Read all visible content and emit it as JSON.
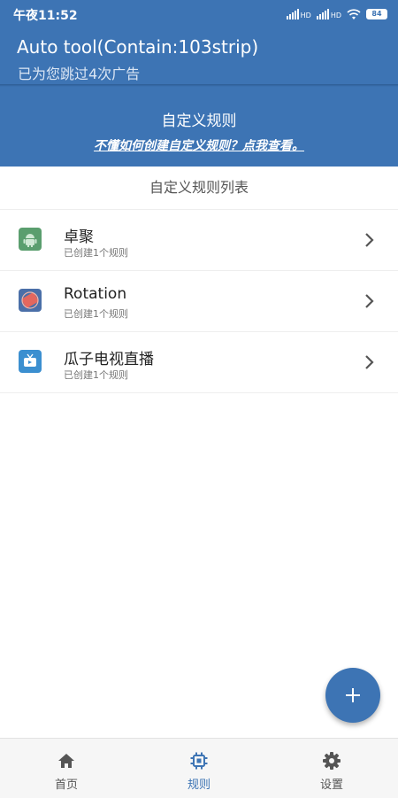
{
  "status_bar": {
    "time": "午夜11:52",
    "signal_label": "HD",
    "battery": "84"
  },
  "app_bar": {
    "title": "Auto tool(Contain:103strip)",
    "subtitle": "已为您跳过4次广告"
  },
  "banner": {
    "title": "自定义规则",
    "link": "不懂如何创建自定义规则？点我查看。"
  },
  "list": {
    "header": "自定义规则列表",
    "items": [
      {
        "title": "卓聚",
        "subtitle": "已创建1个规则",
        "icon": "android-icon"
      },
      {
        "title": "Rotation",
        "subtitle": "已创建1个规则",
        "icon": "rotation-app-icon"
      },
      {
        "title": "瓜子电视直播",
        "subtitle": "已创建1个规则",
        "icon": "tv-app-icon"
      }
    ]
  },
  "fab": {
    "icon": "plus-icon"
  },
  "bottom_nav": {
    "items": [
      {
        "label": "首页",
        "icon": "home-icon"
      },
      {
        "label": "规则",
        "icon": "chip-icon",
        "active": true
      },
      {
        "label": "设置",
        "icon": "gear-icon"
      }
    ]
  },
  "colors": {
    "primary": "#3d74b4",
    "background": "#ffffff",
    "nav_background": "#f6f6f6"
  }
}
